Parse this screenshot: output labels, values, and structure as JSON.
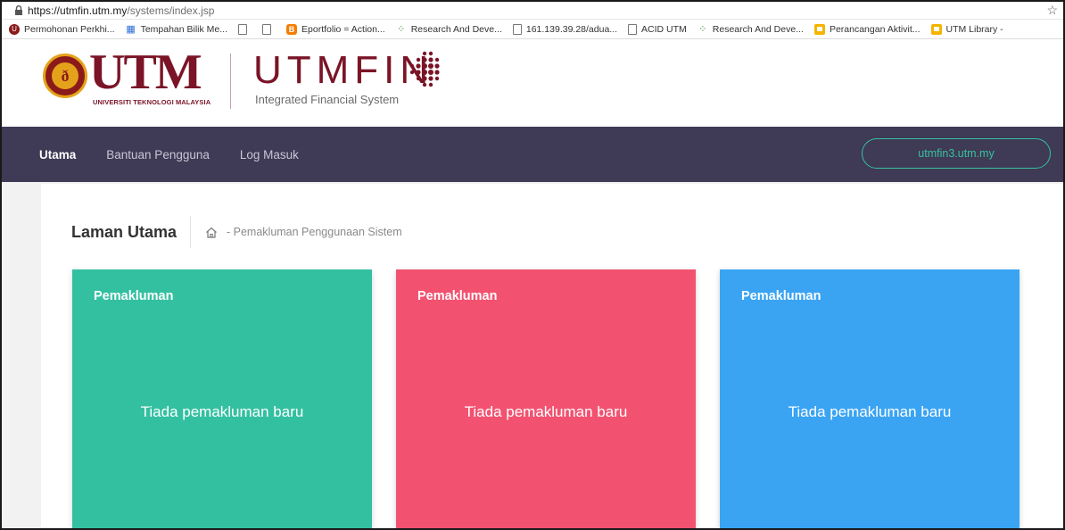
{
  "browser": {
    "url_host": "https://utmfin.utm.my",
    "url_path": "/systems/index.jsp",
    "bookmarks": [
      {
        "icon": "utm-seal-icon",
        "label": "Permohonan Perkhi..."
      },
      {
        "icon": "grid-icon",
        "label": "Tempahan Bilik Me..."
      },
      {
        "icon": "page-icon",
        "label": ""
      },
      {
        "icon": "page-icon",
        "label": ""
      },
      {
        "icon": "blogger-icon",
        "label": "Eportfolio = Action..."
      },
      {
        "icon": "spinner-icon",
        "label": "Research And Deve..."
      },
      {
        "icon": "page-icon",
        "label": "161.139.39.28/adua..."
      },
      {
        "icon": "page-icon",
        "label": "ACID UTM"
      },
      {
        "icon": "spinner-icon",
        "label": "Research And Deve..."
      },
      {
        "icon": "slides-icon",
        "label": "Perancangan Aktivit..."
      },
      {
        "icon": "slides-icon",
        "label": "UTM Library -"
      }
    ]
  },
  "header": {
    "logo_text": "UTM",
    "logo_subtext": "UNIVERSITI TEKNOLOGI MALAYSIA",
    "app_name": "UTMFIN",
    "app_subtitle": "Integrated Financial System",
    "brand_color": "#7a1426"
  },
  "nav": {
    "items": [
      {
        "label": "Utama",
        "active": true
      },
      {
        "label": "Bantuan Pengguna",
        "active": false
      },
      {
        "label": "Log Masuk",
        "active": false
      }
    ],
    "server_label": "utmfin3.utm.my",
    "bg_color": "#3f3a55",
    "accent_color": "#36c1a2"
  },
  "breadcrumb": {
    "title": "Laman Utama",
    "path": "- Pemakluman Penggunaan Sistem"
  },
  "cards": [
    {
      "title": "Pemakluman",
      "body": "Tiada pemakluman baru",
      "color": "#33c0a1"
    },
    {
      "title": "Pemakluman",
      "body": "Tiada pemakluman baru",
      "color": "#f25270"
    },
    {
      "title": "Pemakluman",
      "body": "Tiada pemakluman baru",
      "color": "#3aa4f3"
    }
  ]
}
